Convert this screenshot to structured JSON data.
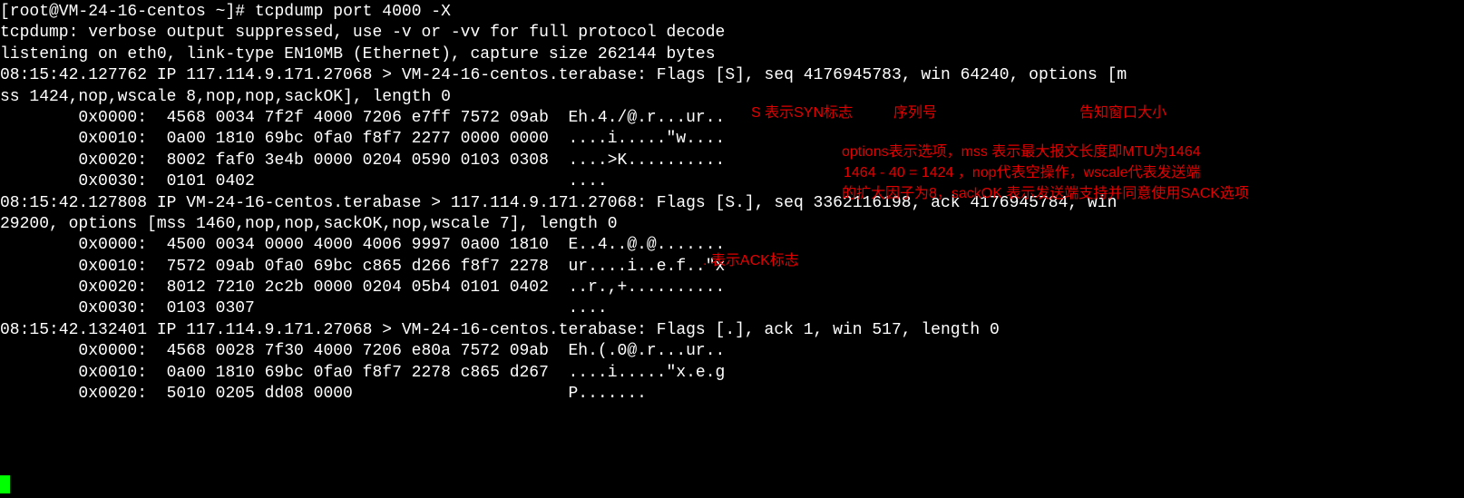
{
  "prompt": "[root@VM-24-16-centos ~]# ",
  "command": "tcpdump port 4000 -X",
  "lines": {
    "l1": "tcpdump: verbose output suppressed, use -v or -vv for full protocol decode",
    "l2": "listening on eth0, link-type EN10MB (Ethernet), capture size 262144 bytes",
    "l3": "08:15:42.127762 IP 117.114.9.171.27068 > VM-24-16-centos.terabase: Flags [S], seq 4176945783, win 64240, options [m",
    "l4": "ss 1424,nop,wscale 8,nop,nop,sackOK], length 0",
    "l5": "        0x0000:  4568 0034 7f2f 4000 7206 e7ff 7572 09ab  Eh.4./@.r...ur..",
    "l6": "        0x0010:  0a00 1810 69bc 0fa0 f8f7 2277 0000 0000  ....i.....\"w....",
    "l7": "        0x0020:  8002 faf0 3e4b 0000 0204 0590 0103 0308  ....>K..........",
    "l8": "        0x0030:  0101 0402                                ....",
    "l9": "08:15:42.127808 IP VM-24-16-centos.terabase > 117.114.9.171.27068: Flags [S.], seq 3362116198, ack 4176945784, win ",
    "l10": "29200, options [mss 1460,nop,nop,sackOK,nop,wscale 7], length 0",
    "l11": "        0x0000:  4500 0034 0000 4000 4006 9997 0a00 1810  E..4..@.@.......",
    "l12": "        0x0010:  7572 09ab 0fa0 69bc c865 d266 f8f7 2278  ur....i..e.f..\"x",
    "l13": "        0x0020:  8012 7210 2c2b 0000 0204 05b4 0101 0402  ..r.,+..........",
    "l14": "        0x0030:  0103 0307                                ....",
    "l15": "08:15:42.132401 IP 117.114.9.171.27068 > VM-24-16-centos.terabase: Flags [.], ack 1, win 517, length 0",
    "l16": "        0x0000:  4568 0028 7f30 4000 7206 e80a 7572 09ab  Eh.(.0@.r...ur..",
    "l17": "        0x0010:  0a00 1810 69bc 0fa0 f8f7 2278 c865 d267  ....i.....\"x.e.g",
    "l18": "        0x0020:  5010 0205 dd08 0000                      P......."
  },
  "annotations": {
    "a1": "S 表示SYN标志",
    "a2": "序列号",
    "a3": "告知窗口大小",
    "a4": "options表示选项，mss 表示最大报文长度即MTU为1464",
    "a5": "1464 - 40 = 1424 ，nop代表空操作，wscale代表发送端",
    "a6": "的扩大因子为8，sackOK 表示发送端支持并同意使用SACK选项",
    "a7": ". 表示ACK标志"
  }
}
